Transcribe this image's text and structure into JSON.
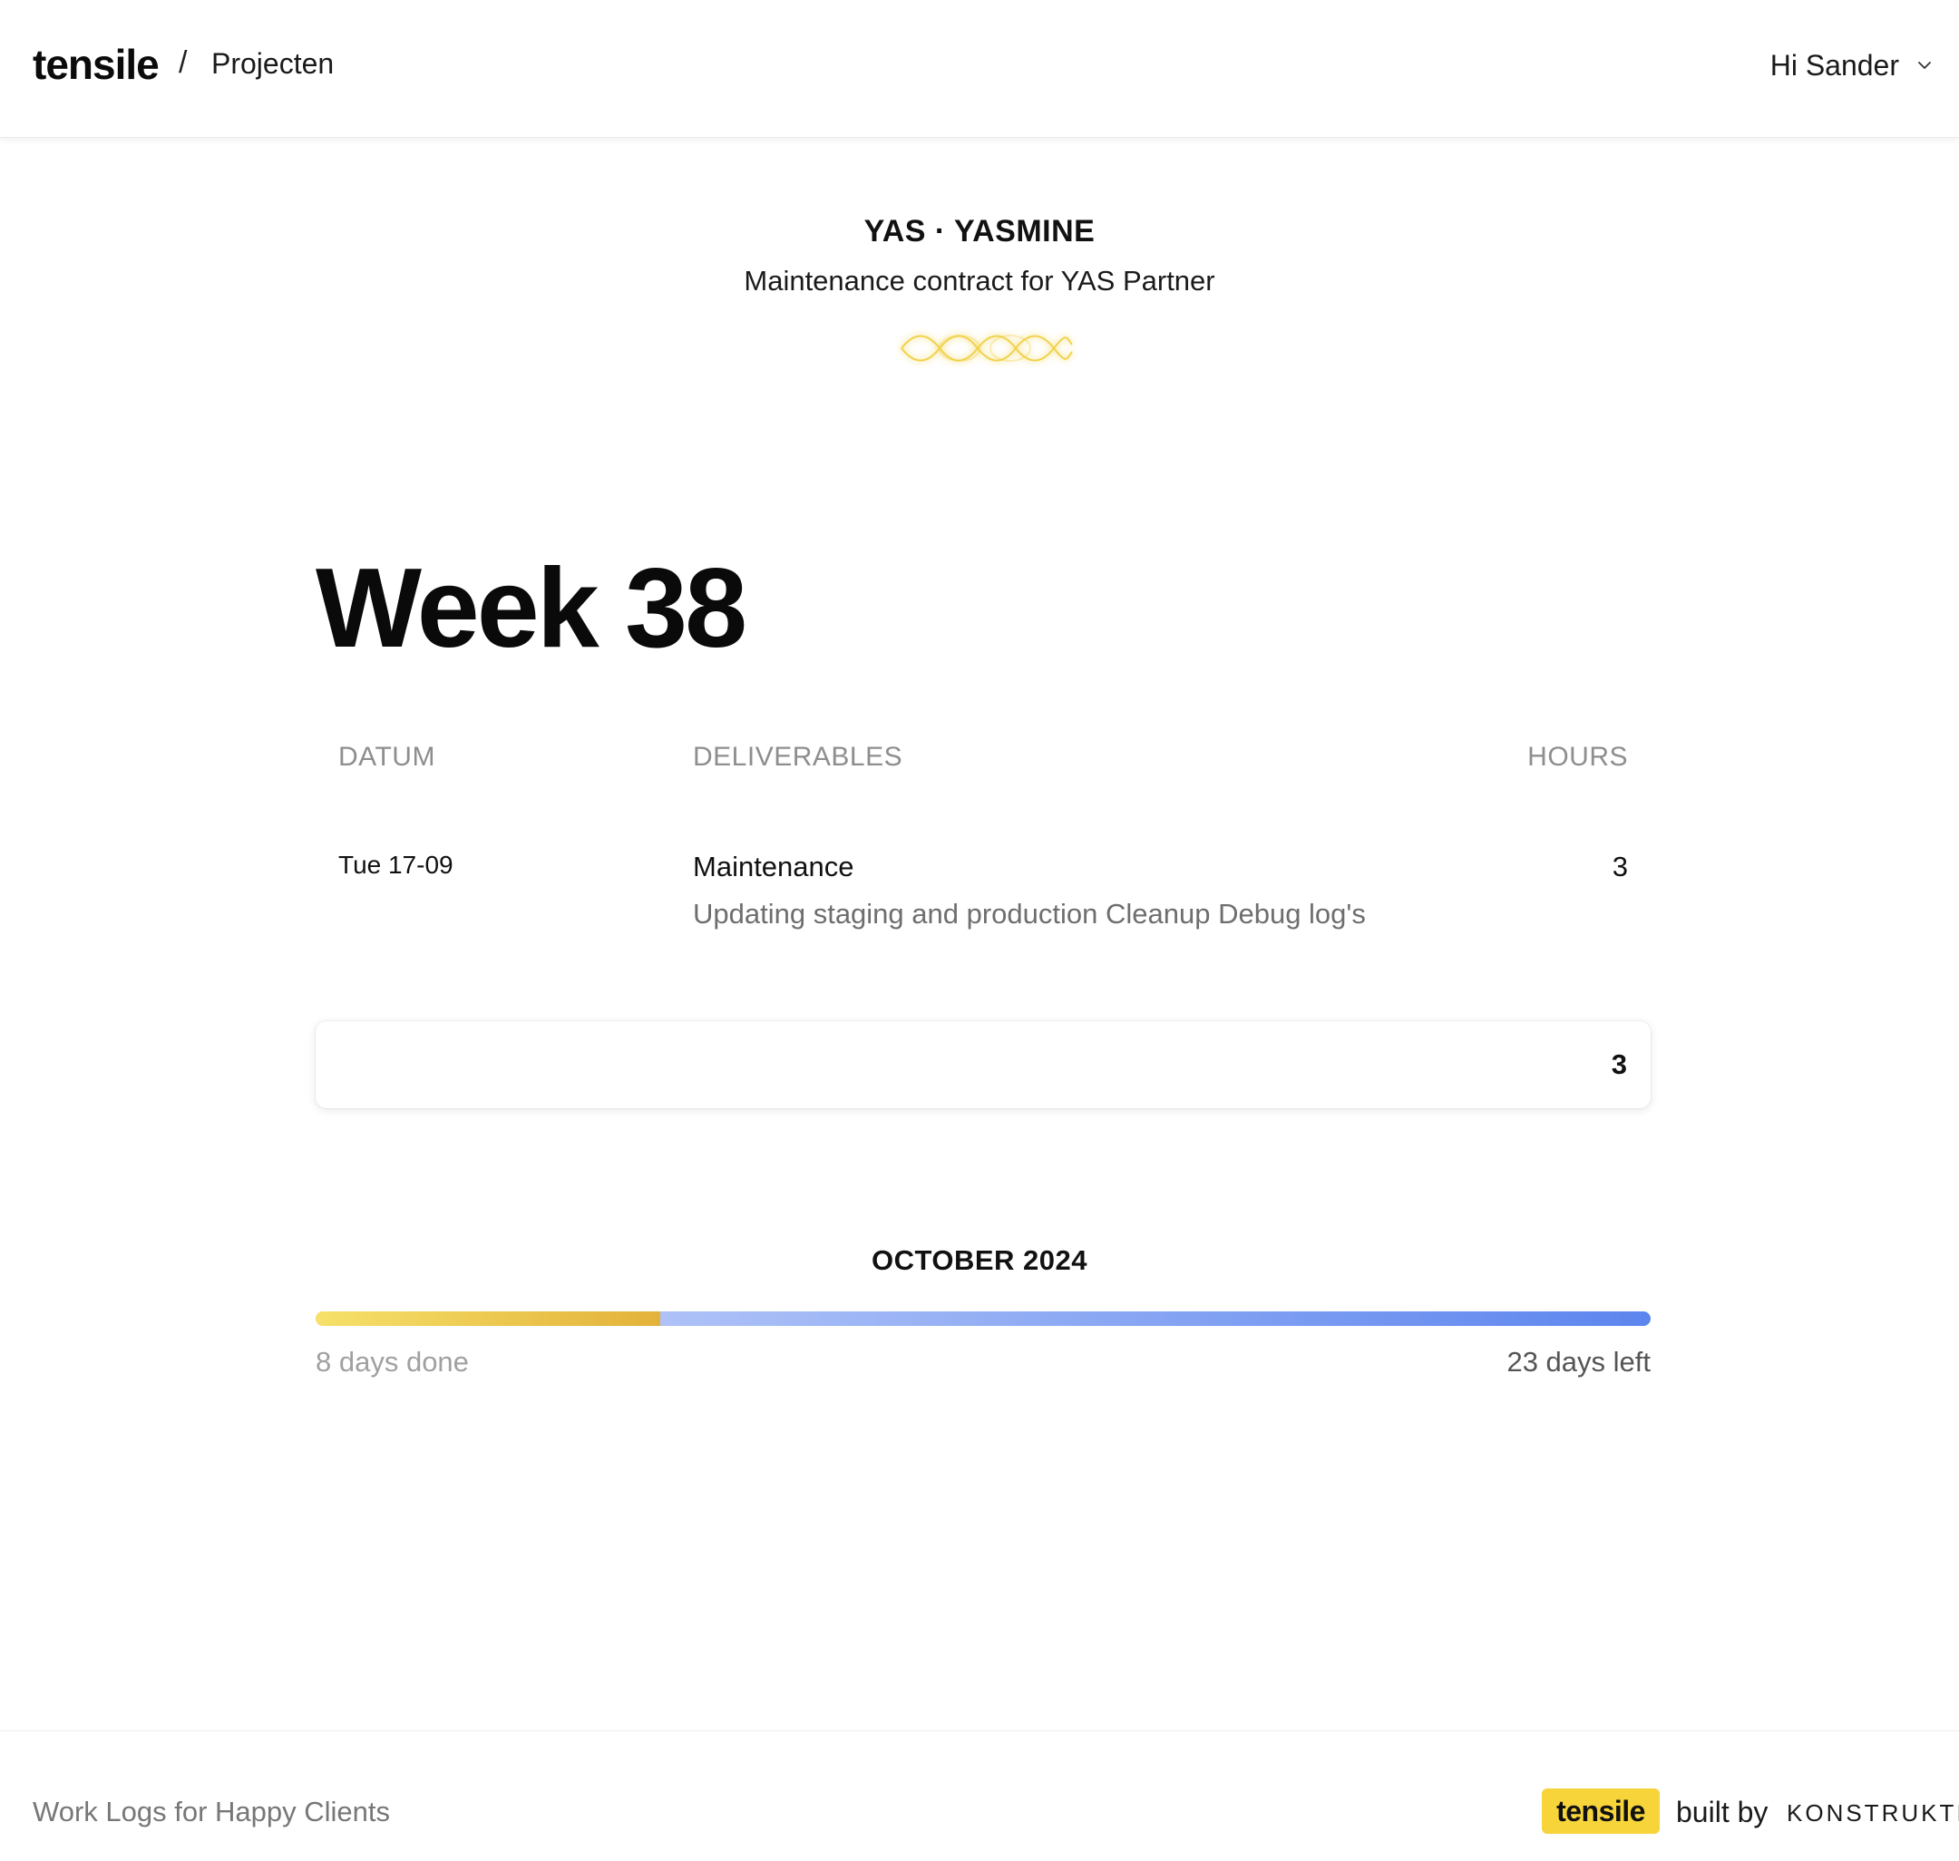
{
  "header": {
    "brand": "tensile",
    "separator": "/",
    "breadcrumb": "Projecten",
    "user_greeting": "Hi Sander"
  },
  "project": {
    "title": "YAS · YASMINE",
    "subtitle": "Maintenance contract for YAS Partner"
  },
  "week": {
    "title": "Week 38",
    "columns": {
      "datum": "DATUM",
      "deliverables": "DELIVERABLES",
      "hours": "HOURS"
    },
    "entries": [
      {
        "date": "Tue 17-09",
        "category": "Maintenance",
        "description": "Updating staging and production Cleanup Debug log's",
        "hours": "3"
      }
    ],
    "total_hours": "3"
  },
  "month": {
    "label": "OCTOBER 2024",
    "days_done": "8 days done",
    "days_left": "23 days left",
    "progress_fraction": 0.258
  },
  "footer": {
    "tagline": "Work Logs for Happy Clients",
    "badge": "tensile",
    "built_by": "built by",
    "maker": "KONSTRUKTIV"
  },
  "colors": {
    "accent_yellow": "#f6d43a",
    "progress_done_start": "#f6e16a",
    "progress_done_end": "#e3b23a",
    "progress_rest_start": "#c9d6fb",
    "progress_rest_end": "#5c85ee"
  },
  "icons": {
    "user_menu": "chevron-down-icon",
    "project_mark": "wave-icon"
  }
}
